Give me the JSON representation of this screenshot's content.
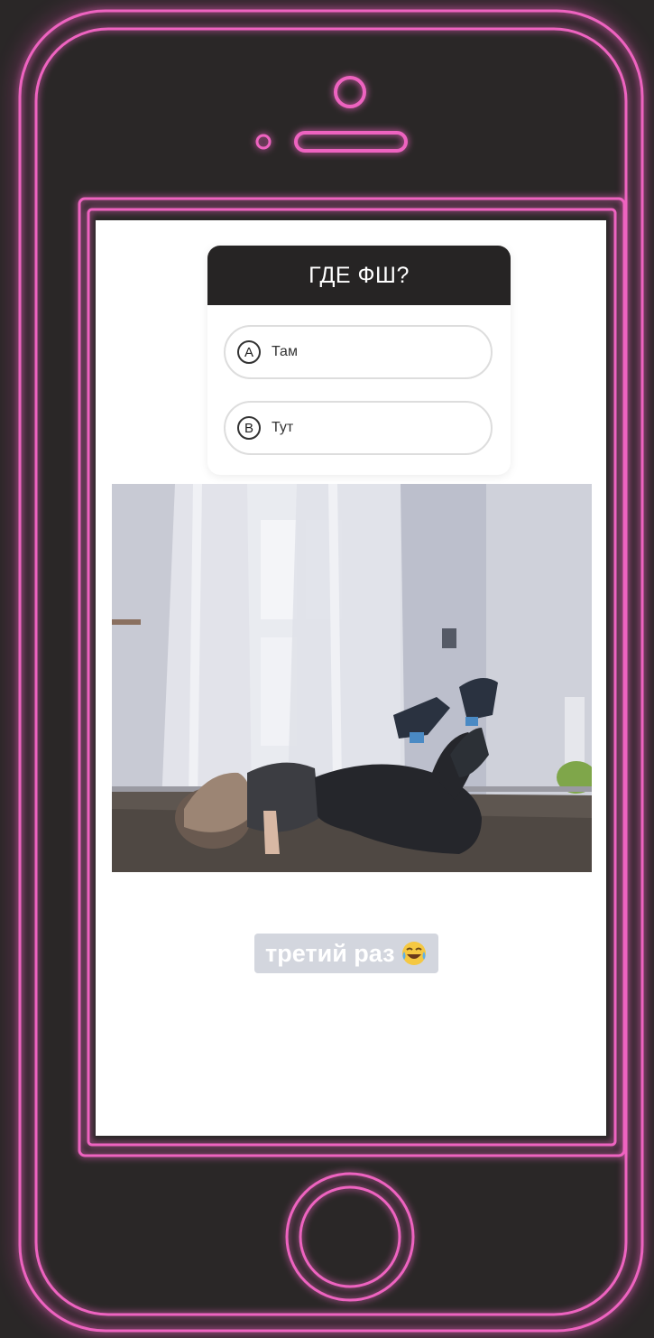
{
  "quiz": {
    "question": "ГДЕ ФШ?",
    "options": [
      {
        "letter": "A",
        "label": "Там"
      },
      {
        "letter": "B",
        "label": "Тут"
      }
    ]
  },
  "caption": {
    "text": "третий раз",
    "emoji": "laughing-tears-emoji"
  },
  "colors": {
    "neon": "#e84fb4",
    "phone_body": "#2a2727",
    "quiz_header": "#262424",
    "caption_bg": "#d3d6de"
  },
  "icons": [
    "speaker-slot-icon",
    "camera-icon",
    "sensor-dot-icon",
    "home-button-icon"
  ]
}
